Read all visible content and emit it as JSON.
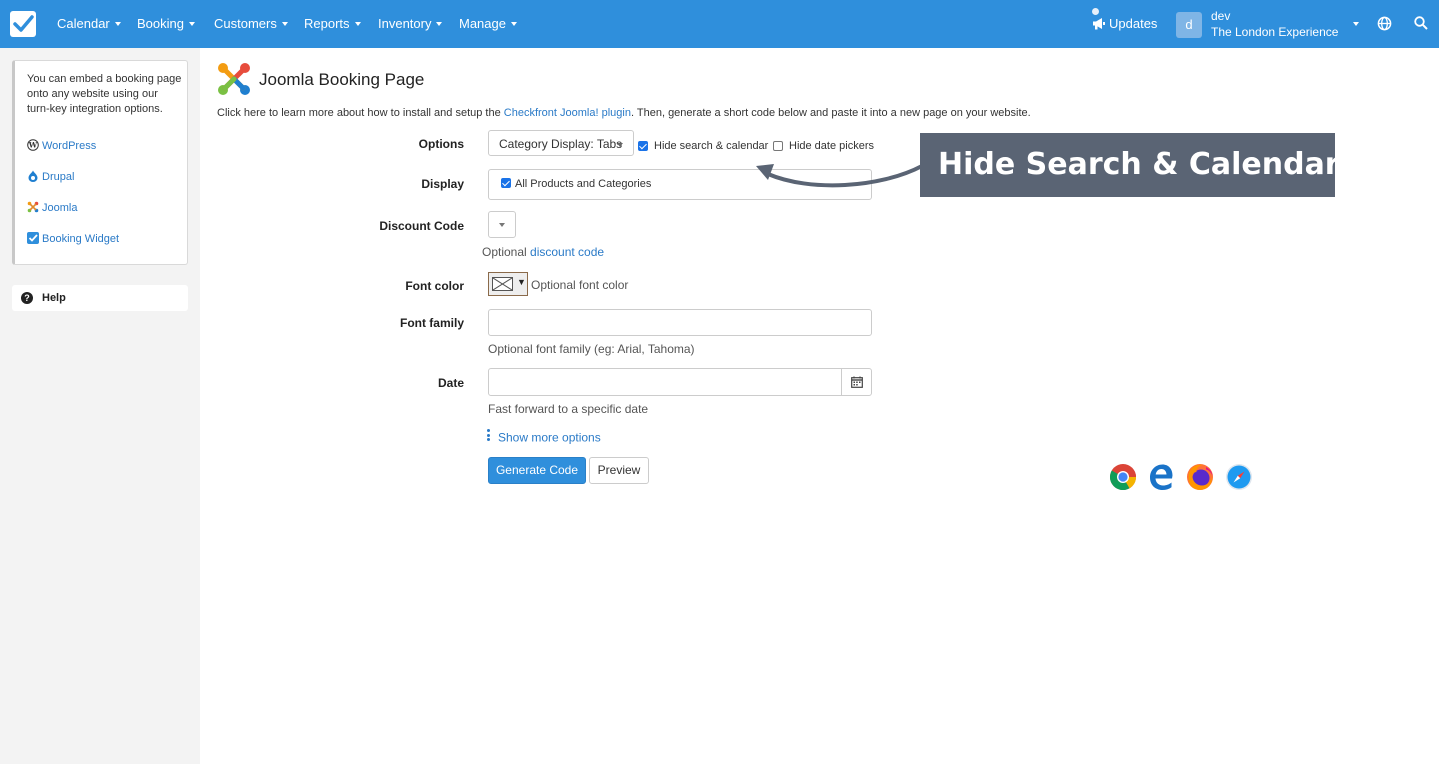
{
  "nav": {
    "items": [
      {
        "label": "Calendar"
      },
      {
        "label": "Booking"
      },
      {
        "label": "Customers"
      },
      {
        "label": "Reports"
      },
      {
        "label": "Inventory"
      },
      {
        "label": "Manage"
      }
    ],
    "updates_label": "Updates",
    "avatar_letter": "d",
    "user_name": "dev",
    "user_org": "The London Experience"
  },
  "sidebar": {
    "intro": "You can embed a booking page onto any website using our turn-key integration options.",
    "links": [
      {
        "label": "WordPress",
        "icon": "wordpress-icon"
      },
      {
        "label": "Drupal",
        "icon": "drupal-icon"
      },
      {
        "label": "Joomla",
        "icon": "joomla-icon"
      },
      {
        "label": "Booking Widget",
        "icon": "checkfront-icon"
      }
    ],
    "help_label": "Help"
  },
  "page": {
    "title": "Joomla Booking Page",
    "intro_before": "Click here to learn more about how to install and setup the ",
    "intro_link": "Checkfront Joomla! plugin",
    "intro_after": ". Then, generate a short code below and paste it into a new page on your website."
  },
  "form": {
    "options_label": "Options",
    "category_display": "Category Display: Tabs",
    "hide_search_label": "Hide search & calendar",
    "hide_search_checked": true,
    "hide_date_label": "Hide date pickers",
    "hide_date_checked": false,
    "display_label": "Display",
    "display_value": "All Products and Categories",
    "display_checked": true,
    "discount_label": "Discount Code",
    "discount_hint_before": "Optional ",
    "discount_hint_link": "discount code",
    "font_color_label": "Font color",
    "font_color_hint": "Optional font color",
    "font_family_label": "Font family",
    "font_family_value": "",
    "font_family_hint": "Optional font family (eg: Arial, Tahoma)",
    "date_label": "Date",
    "date_value": "",
    "date_hint": "Fast forward to a specific date",
    "more_options": "Show more options",
    "generate_label": "Generate Code",
    "preview_label": "Preview"
  },
  "browsers": [
    "chrome-icon",
    "edge-icon",
    "firefox-icon",
    "safari-icon"
  ],
  "callout": {
    "text": "Hide Search & Calendar"
  },
  "colors": {
    "primary": "#2f8fdc",
    "link": "#2a7ac7",
    "callout": "#5a6474"
  }
}
